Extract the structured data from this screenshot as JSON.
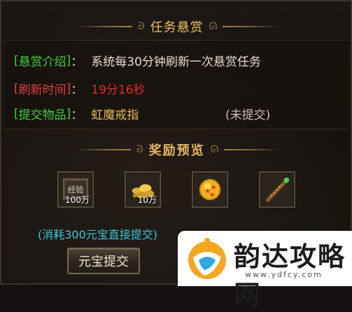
{
  "header": {
    "title": "任务悬赏"
  },
  "info": {
    "intro_label": "悬赏介绍",
    "intro_value": "系统每30分钟刷新一次悬赏任务",
    "refresh_label": "刷新时间",
    "refresh_value": "19分16秒",
    "item_label": "提交物品",
    "item_value": "虹魔戒指",
    "item_status": "(未提交)"
  },
  "rewards": {
    "title": "奖励预览",
    "items": [
      {
        "icon": "exp-scroll-icon",
        "icon_text": "经验",
        "count": "100万"
      },
      {
        "icon": "gold-ingots-icon",
        "count": "10万"
      },
      {
        "icon": "star-orb-icon",
        "count": ""
      },
      {
        "icon": "dagger-icon",
        "count": ""
      }
    ]
  },
  "note": "(消耗300元宝直接提交)",
  "submit_button": "元宝提交",
  "watermark": {
    "name": "韵达攻略网",
    "url": "www.ydfcy.com"
  },
  "colors": {
    "gold_title": "#f0c05a",
    "green_label": "#3fcf38",
    "red_time": "#e02a2a",
    "cyan_note": "#3cc6d8"
  }
}
